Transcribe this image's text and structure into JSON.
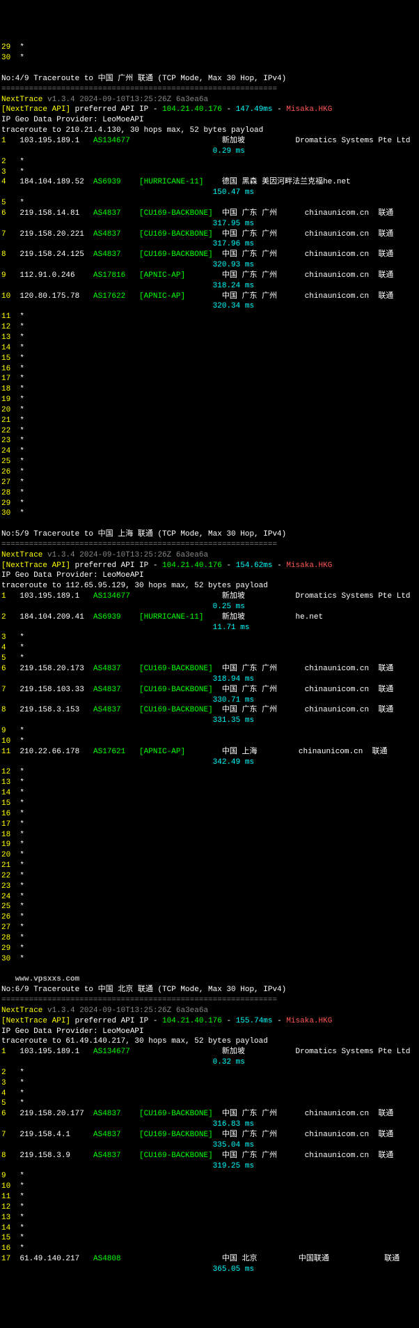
{
  "preamble_hops": [
    {
      "num": "29",
      "star": "*"
    },
    {
      "num": "30",
      "star": "*"
    }
  ],
  "traces": [
    {
      "header": "No:4/9 Traceroute to 中国 广州 联通 (TCP Mode, Max 30 Hop, IPv4)",
      "sep": "============================================================",
      "nexttrace": "NextTrace",
      "version": "v1.3.4 2024-09-10T13:25:26Z 6a3ea6a",
      "api_label": "[NextTrace API]",
      "api_text": " preferred API IP - ",
      "api_ip": "104.21.40.176",
      "api_dash": " - ",
      "api_lat": "147.49ms",
      "api_dash2": " - ",
      "api_loc": "Misaka.HKG",
      "geo": "IP Geo Data Provider: LeoMoeAPI",
      "target": "traceroute to 210.21.4.130, 30 hops max, 52 bytes payload",
      "hops": [
        {
          "num": "1",
          "ip": "103.195.189.1",
          "asn": "AS134677",
          "tag": "",
          "loc": "新加坡",
          "org": "Dromatics Systems Pte Ltd",
          "isp": "",
          "lat": "0.29 ms"
        },
        {
          "num": "2",
          "star": "*"
        },
        {
          "num": "3",
          "star": "*"
        },
        {
          "num": "4",
          "ip": "184.104.189.52",
          "asn": "AS6939",
          "tag": "[HURRICANE-11]",
          "loc": "德国 黑森 美因河畔法兰克福",
          "org": "he.net",
          "isp": "",
          "lat": "150.47 ms"
        },
        {
          "num": "5",
          "star": "*"
        },
        {
          "num": "6",
          "ip": "219.158.14.81",
          "asn": "AS4837",
          "tag": "[CU169-BACKBONE]",
          "loc": "中国 广东 广州",
          "org": "chinaunicom.cn",
          "isp": "联通",
          "lat": "317.95 ms"
        },
        {
          "num": "7",
          "ip": "219.158.20.221",
          "asn": "AS4837",
          "tag": "[CU169-BACKBONE]",
          "loc": "中国 广东 广州",
          "org": "chinaunicom.cn",
          "isp": "联通",
          "lat": "317.96 ms"
        },
        {
          "num": "8",
          "ip": "219.158.24.125",
          "asn": "AS4837",
          "tag": "[CU169-BACKBONE]",
          "loc": "中国 广东 广州",
          "org": "chinaunicom.cn",
          "isp": "联通",
          "lat": "320.93 ms"
        },
        {
          "num": "9",
          "ip": "112.91.0.246",
          "asn": "AS17816",
          "tag": "[APNIC-AP]",
          "loc": "中国 广东 广州",
          "org": "chinaunicom.cn",
          "isp": "联通",
          "lat": "318.24 ms"
        },
        {
          "num": "10",
          "ip": "120.80.175.78",
          "asn": "AS17622",
          "tag": "[APNIC-AP]",
          "loc": "中国 广东 广州",
          "org": "chinaunicom.cn",
          "isp": "联通",
          "lat": "320.34 ms"
        },
        {
          "num": "11",
          "star": "*"
        },
        {
          "num": "12",
          "star": "*"
        },
        {
          "num": "13",
          "star": "*"
        },
        {
          "num": "14",
          "star": "*"
        },
        {
          "num": "15",
          "star": "*"
        },
        {
          "num": "16",
          "star": "*"
        },
        {
          "num": "17",
          "star": "*"
        },
        {
          "num": "18",
          "star": "*"
        },
        {
          "num": "19",
          "star": "*"
        },
        {
          "num": "20",
          "star": "*"
        },
        {
          "num": "21",
          "star": "*"
        },
        {
          "num": "22",
          "star": "*"
        },
        {
          "num": "23",
          "star": "*"
        },
        {
          "num": "24",
          "star": "*"
        },
        {
          "num": "25",
          "star": "*"
        },
        {
          "num": "26",
          "star": "*"
        },
        {
          "num": "27",
          "star": "*"
        },
        {
          "num": "28",
          "star": "*"
        },
        {
          "num": "29",
          "star": "*"
        },
        {
          "num": "30",
          "star": "*"
        }
      ]
    },
    {
      "header": "No:5/9 Traceroute to 中国 上海 联通 (TCP Mode, Max 30 Hop, IPv4)",
      "sep": "============================================================",
      "nexttrace": "NextTrace",
      "version": "v1.3.4 2024-09-10T13:25:26Z 6a3ea6a",
      "api_label": "[NextTrace API]",
      "api_text": " preferred API IP - ",
      "api_ip": "104.21.40.176",
      "api_dash": " - ",
      "api_lat": "154.62ms",
      "api_dash2": " - ",
      "api_loc": "Misaka.HKG",
      "geo": "IP Geo Data Provider: LeoMoeAPI",
      "target": "traceroute to 112.65.95.129, 30 hops max, 52 bytes payload",
      "hops": [
        {
          "num": "1",
          "ip": "103.195.189.1",
          "asn": "AS134677",
          "tag": "",
          "loc": "新加坡",
          "org": "Dromatics Systems Pte Ltd",
          "isp": "",
          "lat": "0.25 ms"
        },
        {
          "num": "2",
          "ip": "184.104.209.41",
          "asn": "AS6939",
          "tag": "[HURRICANE-11]",
          "loc": "新加坡",
          "org": "he.net",
          "isp": "",
          "lat": "11.71 ms"
        },
        {
          "num": "3",
          "star": "*"
        },
        {
          "num": "4",
          "star": "*"
        },
        {
          "num": "5",
          "star": "*"
        },
        {
          "num": "6",
          "ip": "219.158.20.173",
          "asn": "AS4837",
          "tag": "[CU169-BACKBONE]",
          "loc": "中国 广东 广州",
          "org": "chinaunicom.cn",
          "isp": "联通",
          "lat": "318.94 ms"
        },
        {
          "num": "7",
          "ip": "219.158.103.33",
          "asn": "AS4837",
          "tag": "[CU169-BACKBONE]",
          "loc": "中国 广东 广州",
          "org": "chinaunicom.cn",
          "isp": "联通",
          "lat": "330.71 ms"
        },
        {
          "num": "8",
          "ip": "219.158.3.153",
          "asn": "AS4837",
          "tag": "[CU169-BACKBONE]",
          "loc": "中国 广东 广州",
          "org": "chinaunicom.cn",
          "isp": "联通",
          "lat": "331.35 ms"
        },
        {
          "num": "9",
          "star": "*"
        },
        {
          "num": "10",
          "star": "*"
        },
        {
          "num": "11",
          "ip": "210.22.66.178",
          "asn": "AS17621",
          "tag": "[APNIC-AP]",
          "loc": "中国 上海",
          "org": "chinaunicom.cn",
          "isp": "联通",
          "lat": "342.49 ms"
        },
        {
          "num": "12",
          "star": "*"
        },
        {
          "num": "13",
          "star": "*"
        },
        {
          "num": "14",
          "star": "*"
        },
        {
          "num": "15",
          "star": "*"
        },
        {
          "num": "16",
          "star": "*"
        },
        {
          "num": "17",
          "star": "*"
        },
        {
          "num": "18",
          "star": "*"
        },
        {
          "num": "19",
          "star": "*"
        },
        {
          "num": "20",
          "star": "*"
        },
        {
          "num": "21",
          "star": "*"
        },
        {
          "num": "22",
          "star": "*"
        },
        {
          "num": "23",
          "star": "*"
        },
        {
          "num": "24",
          "star": "*"
        },
        {
          "num": "25",
          "star": "*"
        },
        {
          "num": "26",
          "star": "*"
        },
        {
          "num": "27",
          "star": "*"
        },
        {
          "num": "28",
          "star": "*"
        },
        {
          "num": "29",
          "star": "*"
        },
        {
          "num": "30",
          "star": "*"
        }
      ]
    },
    {
      "watermark": "www.vpsxxs.com",
      "header": "No:6/9 Traceroute to 中国 北京 联通 (TCP Mode, Max 30 Hop, IPv4)",
      "sep": "============================================================",
      "nexttrace": "NextTrace",
      "version": "v1.3.4 2024-09-10T13:25:26Z 6a3ea6a",
      "api_label": "[NextTrace API]",
      "api_text": " preferred API IP - ",
      "api_ip": "104.21.40.176",
      "api_dash": " - ",
      "api_lat": "155.74ms",
      "api_dash2": " - ",
      "api_loc": "Misaka.HKG",
      "geo": "IP Geo Data Provider: LeoMoeAPI",
      "target": "traceroute to 61.49.140.217, 30 hops max, 52 bytes payload",
      "hops": [
        {
          "num": "1",
          "ip": "103.195.189.1",
          "asn": "AS134677",
          "tag": "",
          "loc": "新加坡",
          "org": "Dromatics Systems Pte Ltd",
          "isp": "",
          "lat": "0.32 ms"
        },
        {
          "num": "2",
          "star": "*"
        },
        {
          "num": "3",
          "star": "*"
        },
        {
          "num": "4",
          "star": "*"
        },
        {
          "num": "5",
          "star": "*"
        },
        {
          "num": "6",
          "ip": "219.158.20.177",
          "asn": "AS4837",
          "tag": "[CU169-BACKBONE]",
          "loc": "中国 广东 广州",
          "org": "chinaunicom.cn",
          "isp": "联通",
          "lat": "316.83 ms"
        },
        {
          "num": "7",
          "ip": "219.158.4.1",
          "asn": "AS4837",
          "tag": "[CU169-BACKBONE]",
          "loc": "中国 广东 广州",
          "org": "chinaunicom.cn",
          "isp": "联通",
          "lat": "335.04 ms"
        },
        {
          "num": "8",
          "ip": "219.158.3.9",
          "asn": "AS4837",
          "tag": "[CU169-BACKBONE]",
          "loc": "中国 广东 广州",
          "org": "chinaunicom.cn",
          "isp": "联通",
          "lat": "319.25 ms"
        },
        {
          "num": "9",
          "star": "*"
        },
        {
          "num": "10",
          "star": "*"
        },
        {
          "num": "11",
          "star": "*"
        },
        {
          "num": "12",
          "star": "*"
        },
        {
          "num": "13",
          "star": "*"
        },
        {
          "num": "14",
          "star": "*"
        },
        {
          "num": "15",
          "star": "*"
        },
        {
          "num": "16",
          "star": "*"
        },
        {
          "num": "17",
          "ip": "61.49.140.217",
          "asn": "AS4808",
          "tag": "",
          "loc": "中国 北京",
          "org": "中国联通",
          "isp": "联通",
          "lat": "365.05 ms"
        }
      ]
    }
  ]
}
